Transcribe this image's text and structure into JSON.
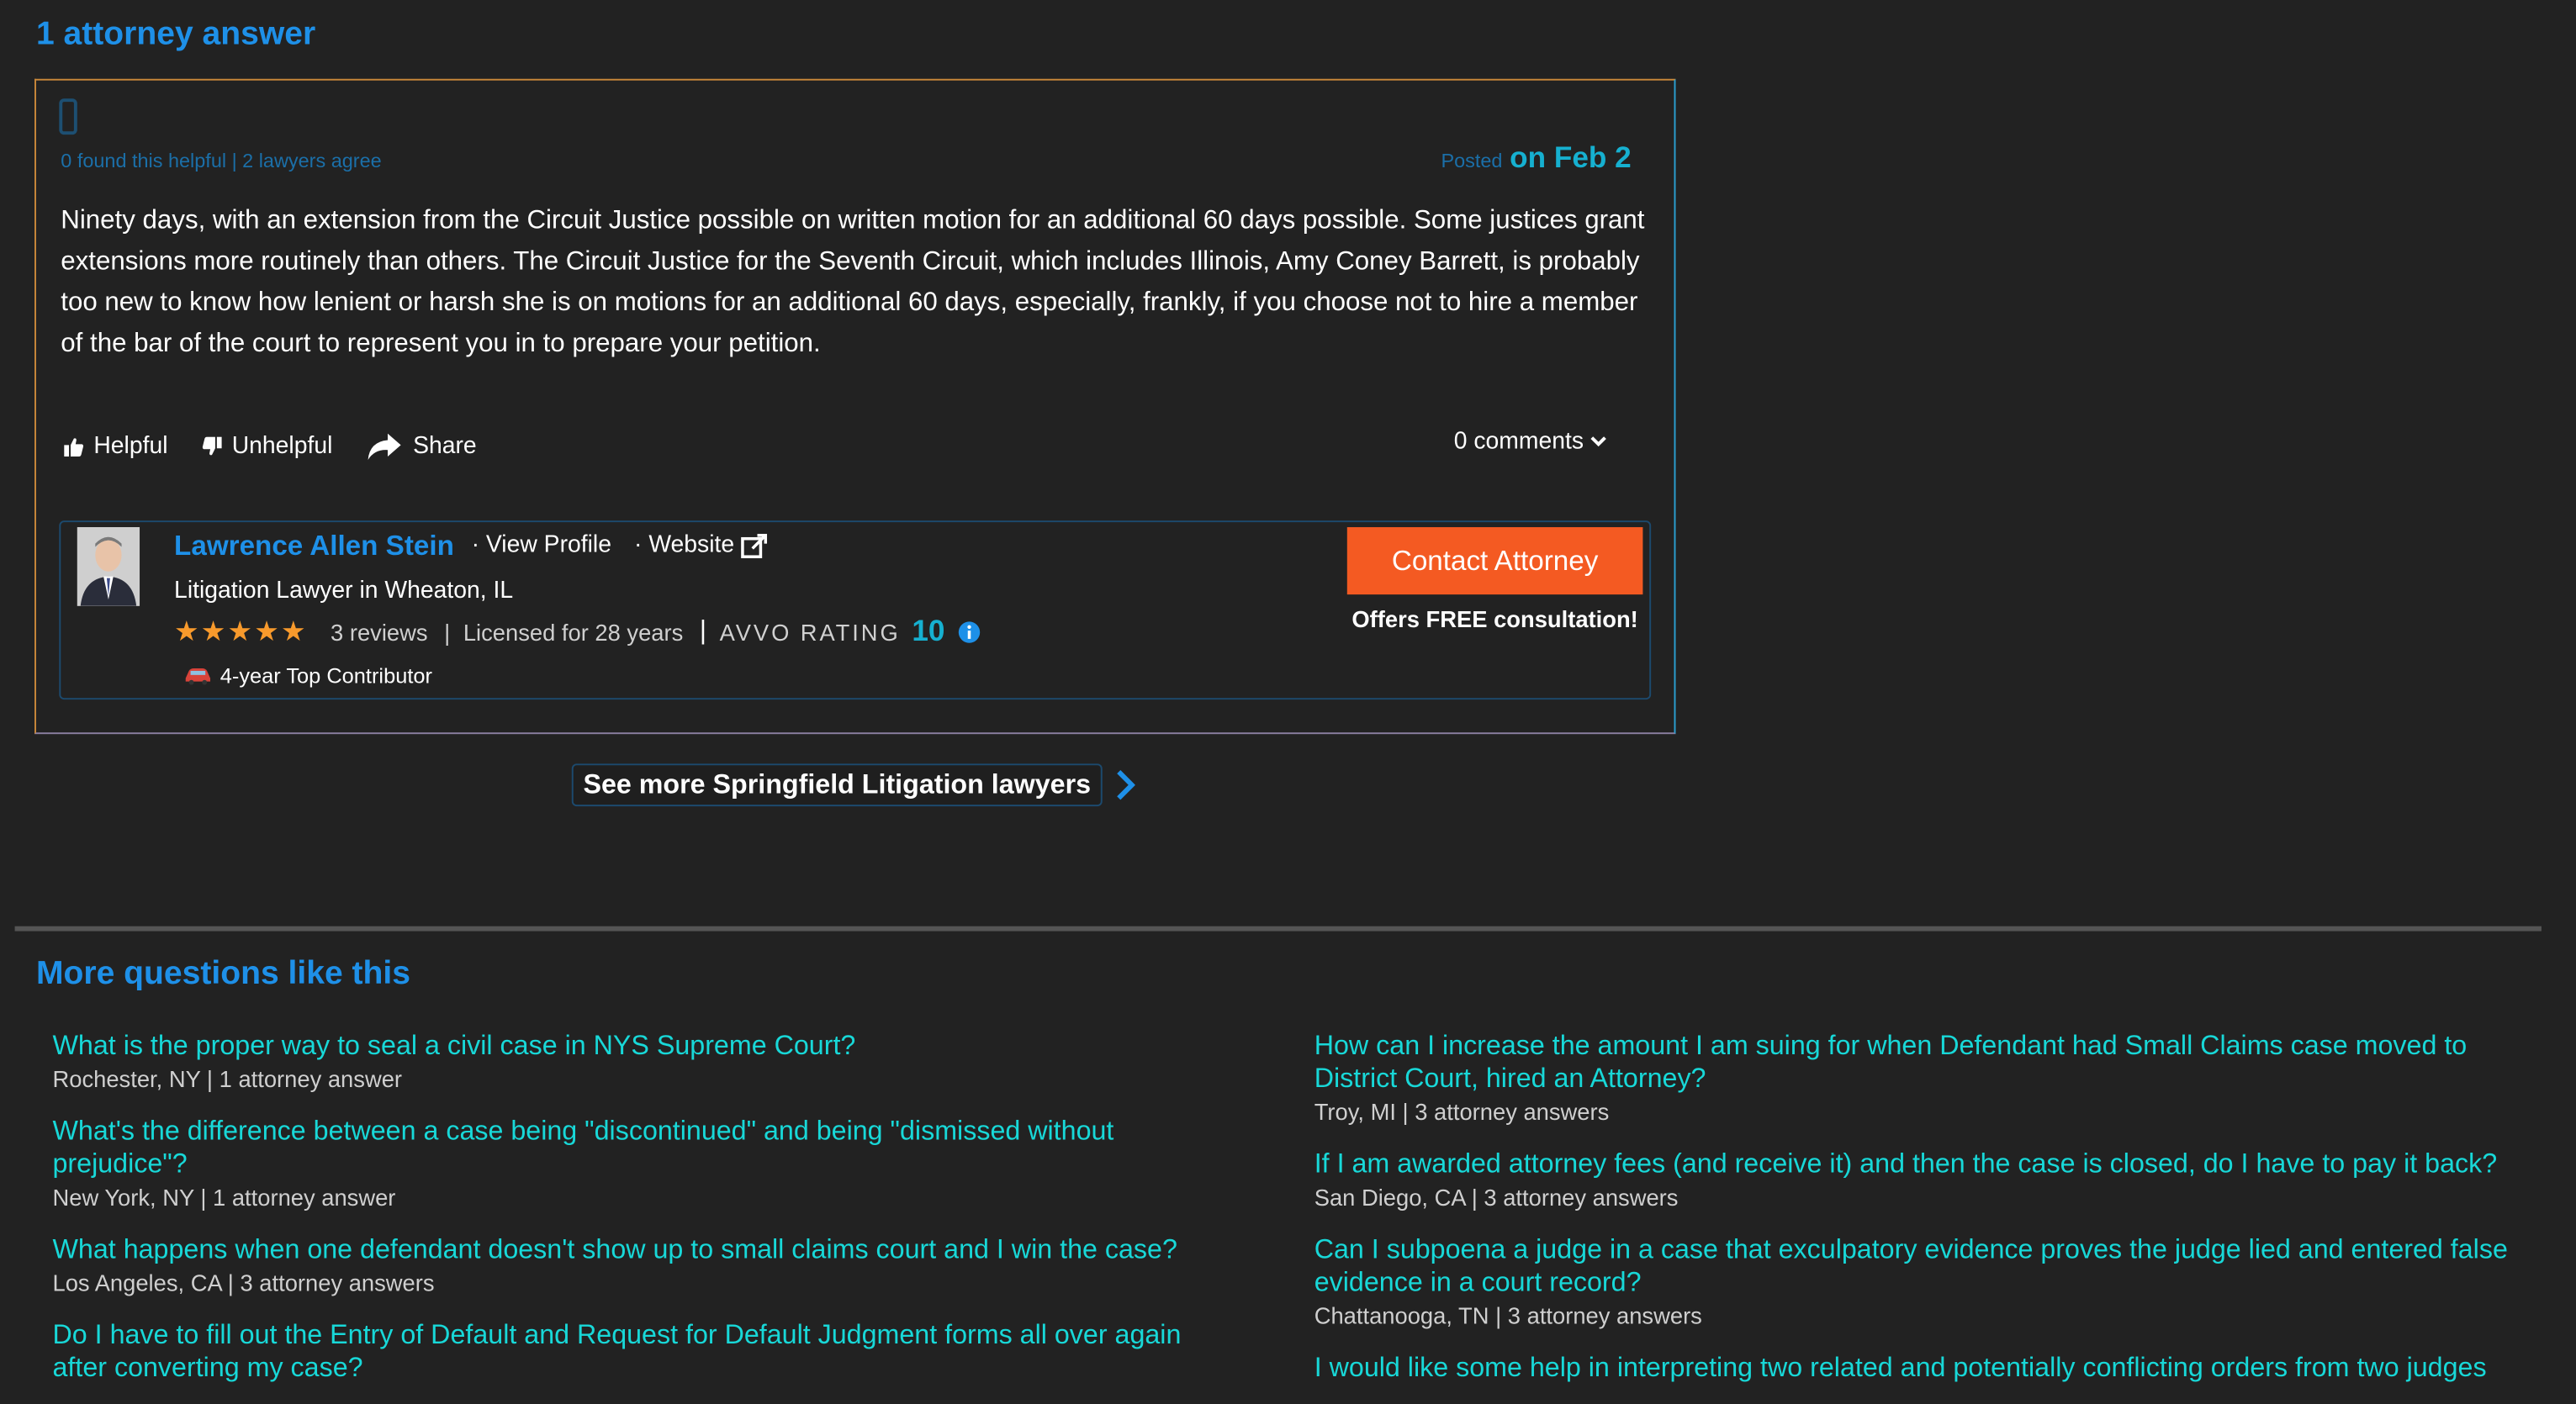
{
  "answers_header": "1 attorney answer",
  "answer": {
    "helpful_meta": "0 found this helpful | 2 lawyers agree",
    "posted_label": "Posted",
    "posted_date": "on Feb 2",
    "text": "Ninety days, with an extension from the Circuit Justice possible on written motion for an additional 60 days possible. Some justices grant extensions more routinely than others. The Circuit Justice for the Seventh Circuit, which includes Illinois, Amy Coney Barrett, is probably too new to know how lenient or harsh she is on motions for an additional 60 days, especially, frankly, if you choose not to hire a member of the bar of the court to represent you in to prepare your petition.",
    "actions": {
      "helpful": "Helpful",
      "unhelpful": "Unhelpful",
      "share": "Share"
    },
    "comments": "0 comments"
  },
  "lawyer": {
    "name": "Lawrence Allen Stein",
    "view_profile": "· View Profile",
    "website": "· Website",
    "title": "Litigation Lawyer in Wheaton, IL",
    "stars": "★★★★★",
    "reviews": "3 reviews",
    "licensed": "Licensed for 28 years",
    "avvo_label": "AVVO RATING",
    "avvo_rating": "10",
    "contributor": "4-year Top Contributor",
    "contact_button": "Contact Attorney",
    "consultation": "Offers FREE consultation!"
  },
  "see_more": "See more Springfield Litigation lawyers",
  "more_questions": {
    "title": "More questions like this",
    "left": [
      {
        "question": "What is the proper way to seal a civil case in NYS Supreme Court?",
        "meta": "Rochester, NY | 1 attorney answer"
      },
      {
        "question": "What's the difference between a case being \"discontinued\" and being \"dismissed without prejudice\"?",
        "meta": "New York, NY | 1 attorney answer"
      },
      {
        "question": "What happens when one defendant doesn't show up to small claims court and I win the case?",
        "meta": "Los Angeles, CA | 3 attorney answers"
      },
      {
        "question": "Do I have to fill out the Entry of Default and Request for Default Judgment forms all over again after converting my case?",
        "meta": ""
      }
    ],
    "right": [
      {
        "question": "How can I increase the amount I am suing for when Defendant had Small Claims case moved to District Court, hired an Attorney?",
        "meta": "Troy, MI | 3 attorney answers"
      },
      {
        "question": "If I am awarded attorney fees (and receive it) and then the case is closed, do I have to pay it back?",
        "meta": "San Diego, CA | 3 attorney answers"
      },
      {
        "question": "Can I subpoena a judge in a case that exculpatory evidence proves the judge lied and entered false evidence in a court record?",
        "meta": "Chattanooga, TN | 3 attorney answers"
      },
      {
        "question": "I would like some help in interpreting two related and potentially conflicting orders from two judges",
        "meta": ""
      }
    ]
  },
  "colors": {
    "link": "#1e90e8",
    "question_link": "#18d8d8",
    "accent": "#f45a22",
    "background": "#222222"
  }
}
